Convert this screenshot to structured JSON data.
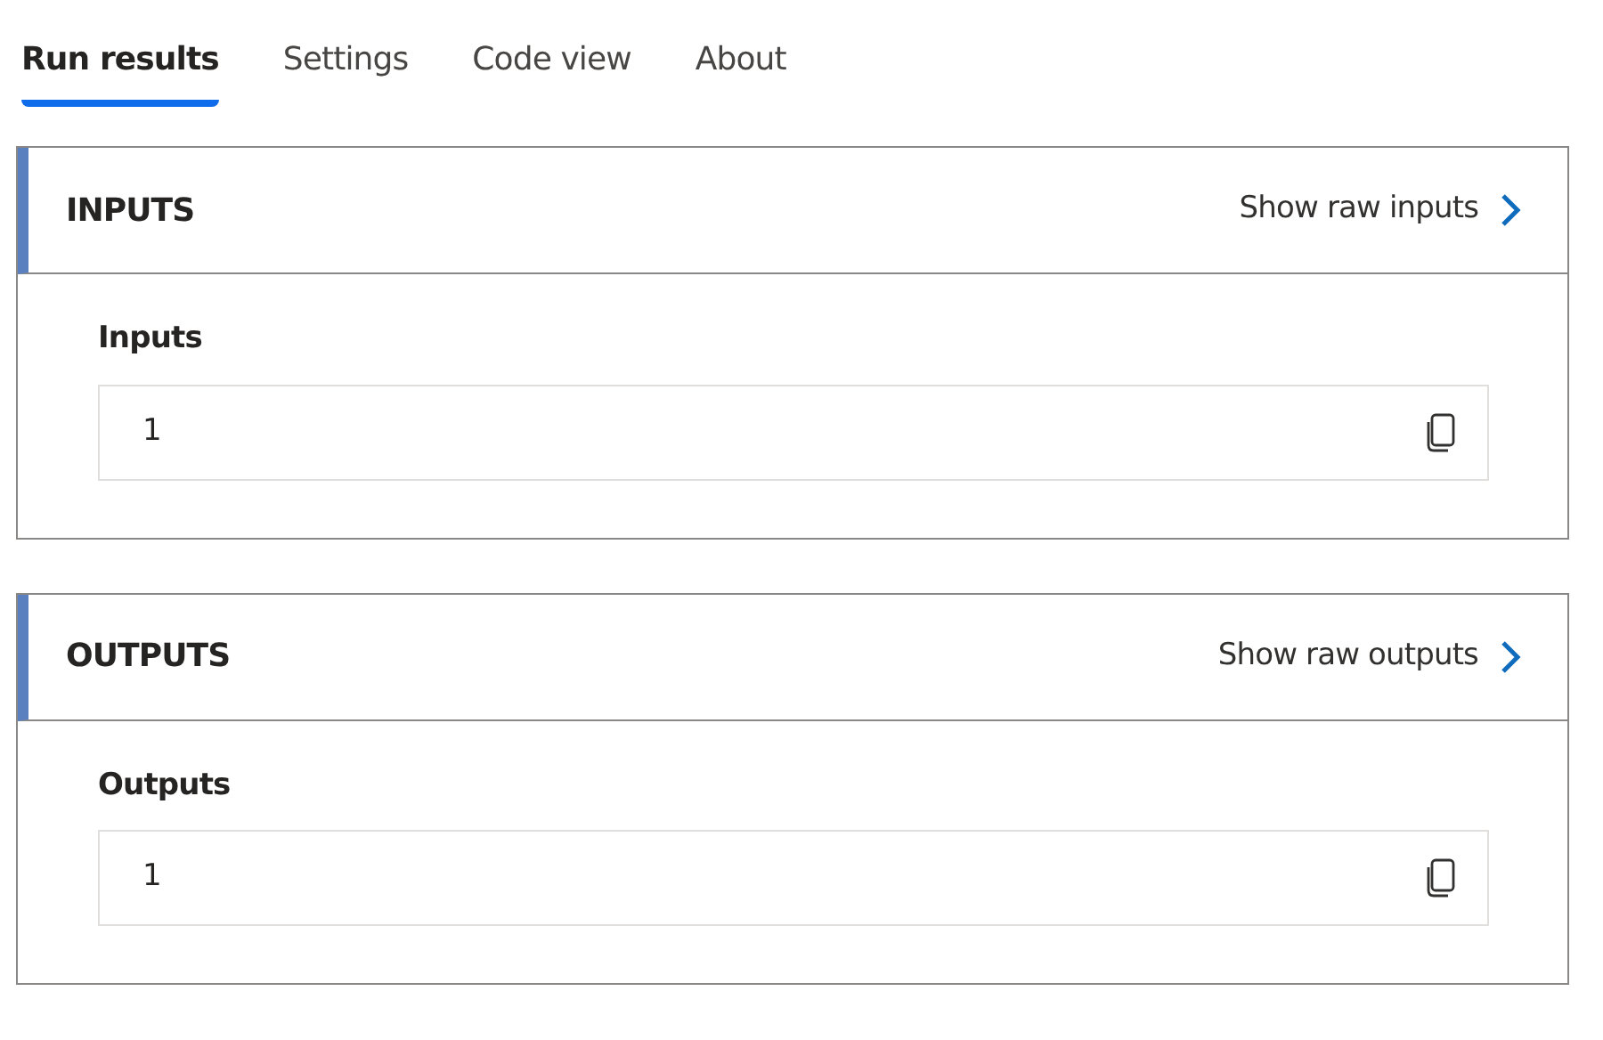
{
  "tabs": [
    {
      "label": "Run results",
      "selected": true
    },
    {
      "label": "Settings",
      "selected": false
    },
    {
      "label": "Code view",
      "selected": false
    },
    {
      "label": "About",
      "selected": false
    }
  ],
  "sections": [
    {
      "title": "INPUTS",
      "link": "Show raw inputs",
      "field_label": "Inputs",
      "value": "1"
    },
    {
      "title": "OUTPUTS",
      "link": "Show raw outputs",
      "field_label": "Outputs",
      "value": "1"
    }
  ]
}
